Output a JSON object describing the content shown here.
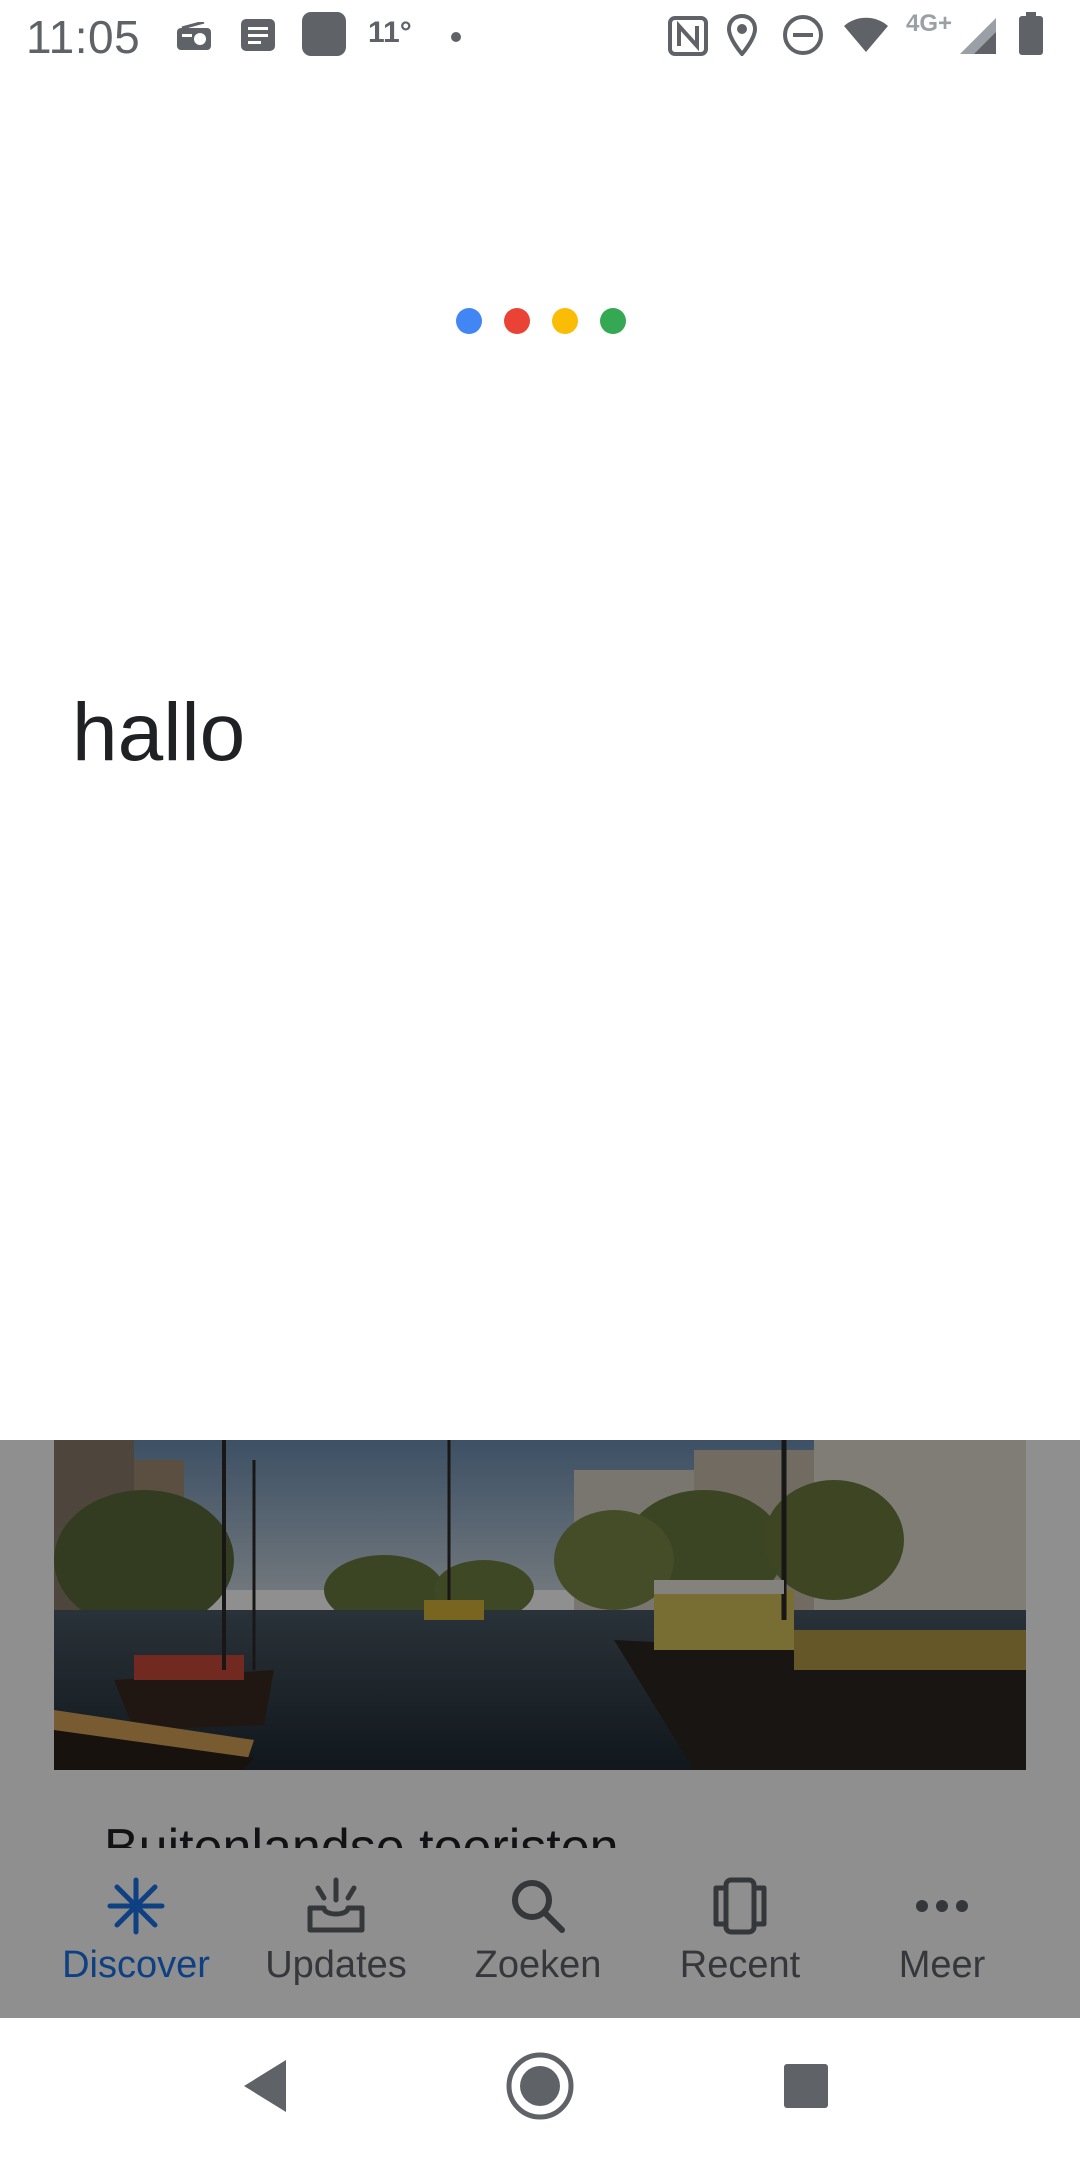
{
  "status_bar": {
    "time": "11:05",
    "temperature": "11°",
    "network_label": "4G+",
    "icons": [
      "radio-icon",
      "news-icon",
      "app-icon",
      "dot-icon",
      "nfc-icon",
      "location-icon",
      "do-not-disturb-icon",
      "wifi-icon",
      "signal-icon",
      "battery-icon"
    ]
  },
  "assistant": {
    "query_text": "hallo",
    "dot_colors": [
      "#4285F4",
      "#EA4335",
      "#FBBC05",
      "#34A853"
    ]
  },
  "background_app": {
    "card": {
      "title": "Buitenlandse toeristen"
    },
    "bottom_nav": [
      {
        "label": "Discover",
        "icon": "discover-icon",
        "active": true
      },
      {
        "label": "Updates",
        "icon": "updates-icon",
        "active": false
      },
      {
        "label": "Zoeken",
        "icon": "search-icon",
        "active": false
      },
      {
        "label": "Recent",
        "icon": "recent-icon",
        "active": false
      },
      {
        "label": "Meer",
        "icon": "more-icon",
        "active": false
      }
    ]
  },
  "system_nav": [
    "back-icon",
    "home-icon",
    "overview-icon"
  ],
  "colors": {
    "active_tab": "#1a73e8",
    "scrim": "rgba(0,0,0,0.44)"
  }
}
